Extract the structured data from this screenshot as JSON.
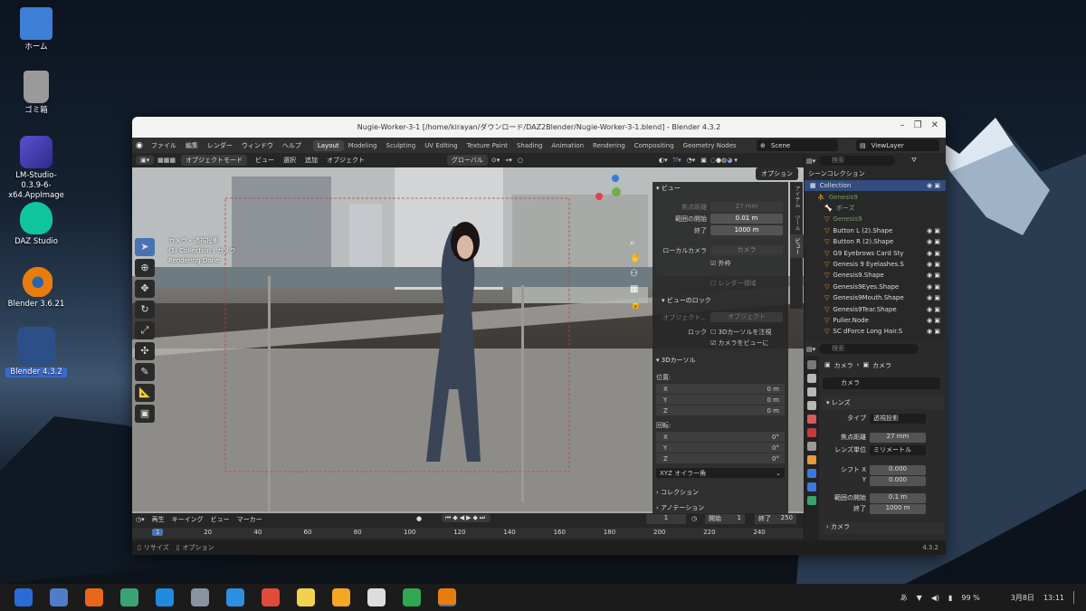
{
  "desktop": {
    "icons": [
      {
        "name": "home",
        "label": "ホーム",
        "color": "#3d7fd6"
      },
      {
        "name": "trash",
        "label": "ゴミ箱",
        "color": "#b0b0b0"
      },
      {
        "name": "lmstudio",
        "label": "LM-Studio-0.3.9-6-x64.AppImage",
        "color": "#4a3aa8"
      },
      {
        "name": "daz",
        "label": "DAZ Studio",
        "color": "#0fc5a0"
      },
      {
        "name": "blender1",
        "label": "Blender 3.6.21",
        "color": "#e87d0d"
      },
      {
        "name": "blender2",
        "label": "Blender 4.3.2",
        "color": "#e87d0d"
      }
    ]
  },
  "window": {
    "title": "Nugie-Worker-3-1 [/home/kirayan/ダウンロード/DAZ2Blender/Nugie-Worker-3-1.blend] - Blender 4.3.2"
  },
  "menus": [
    "ファイル",
    "編集",
    "レンダー",
    "ウィンドウ",
    "ヘルプ"
  ],
  "workspaces": [
    "Layout",
    "Modeling",
    "Sculpting",
    "UV Editing",
    "Texture Paint",
    "Shading",
    "Animation",
    "Rendering",
    "Compositing",
    "Geometry Nodes"
  ],
  "scene": "Scene",
  "viewlayer": "ViewLayer",
  "viewport": {
    "mode": "オブジェクトモード",
    "menu": [
      "ビュー",
      "選択",
      "追加",
      "オブジェクト"
    ],
    "orient": "グローバル",
    "options": "オプション",
    "cam1": "カメラ・透視投影",
    "cam2": "(1) Collection | カメラ",
    "cam3": "Rendering Done"
  },
  "npanel": {
    "view_title": "ビュー",
    "focal_label": "焦点距離",
    "focal": "27 mm",
    "clip_start_label": "範囲の開始",
    "clip_start": "0.01 m",
    "clip_end_label": "終了",
    "clip_end": "1000 m",
    "local_cam_label": "ローカルカメラ",
    "local_cam": "カメラ",
    "frame": "外枠",
    "render_region": "レンダー領域",
    "lock_title": "ビューのロック",
    "lock_obj_label": "オブジェクト...",
    "lock_obj": "オブジェクト",
    "lock_label": "ロック",
    "lock_cursor": "3Dカーソルを注視",
    "lock_cam": "カメラをビューに",
    "cursor_title": "3Dカーソル",
    "loc": "位置:",
    "x": "X",
    "y": "Y",
    "z": "Z",
    "zero_m": "0 m",
    "rot": "回転:",
    "zero_d": "0°",
    "euler": "XYZ オイラー角",
    "collection": "コレクション",
    "annotation": "アノテーション",
    "tabs": [
      "アイテム",
      "ツール",
      "ビュー"
    ]
  },
  "outliner": {
    "title": "シーンコレクション",
    "search": "検索",
    "rows": [
      {
        "t": "Collection",
        "i": 0
      },
      {
        "t": "Genesis9",
        "i": 1
      },
      {
        "t": "ポーズ",
        "i": 2
      },
      {
        "t": "Genesis9",
        "i": 2
      },
      {
        "t": "Button L (2).Shape",
        "i": 2
      },
      {
        "t": "Button R (2).Shape",
        "i": 2
      },
      {
        "t": "G9 Eyebrows Card Sty",
        "i": 2
      },
      {
        "t": "Genesis 9 Eyelashes.S",
        "i": 2
      },
      {
        "t": "Genesis9.Shape",
        "i": 2
      },
      {
        "t": "Genesis9Eyes.Shape",
        "i": 2
      },
      {
        "t": "Genesis9Mouth.Shape",
        "i": 2
      },
      {
        "t": "Genesis9Tear.Shape",
        "i": 2
      },
      {
        "t": "Puller.Node",
        "i": 2
      },
      {
        "t": "SC dForce Long Hair.S",
        "i": 2
      }
    ],
    "num": "156"
  },
  "props": {
    "search": "検索",
    "crumb1": "カメラ",
    "crumb2": "カメラ",
    "data": "カメラ",
    "lens": "レンズ",
    "type_label": "タイプ",
    "type": "透視投影",
    "focal_label": "焦点距離",
    "focal": "27 mm",
    "unit_label": "レンズ単位",
    "unit": "ミリメートル",
    "shiftx_label": "シフト X",
    "shiftx": "0.000",
    "shifty_label": "Y",
    "shifty": "0.000",
    "clip_start_label": "範囲の開始",
    "clip_start": "0.1 m",
    "clip_end_label": "終了",
    "clip_end": "1000 m",
    "camera": "カメラ"
  },
  "timeline": {
    "menus": [
      "再生",
      "キーイング",
      "ビュー",
      "マーカー"
    ],
    "frame": "1",
    "start_label": "開始",
    "start": "1",
    "end_label": "終了",
    "end": "250",
    "ticks": [
      "1",
      "20",
      "40",
      "60",
      "80",
      "100",
      "120",
      "140",
      "160",
      "180",
      "200",
      "220",
      "240"
    ]
  },
  "status": {
    "left1": "リサイズ",
    "left2": "オプション",
    "version": "4.3.2"
  },
  "taskbar": {
    "ime": "あ",
    "battery": "99 %",
    "date": "3月8日",
    "time": "13:11",
    "apps": [
      {
        "n": "zorin",
        "c": "#2b6bd6"
      },
      {
        "n": "files-grid",
        "c": "#4f7dc9"
      },
      {
        "n": "firefox",
        "c": "#e8671b"
      },
      {
        "n": "archive",
        "c": "#3aa374"
      },
      {
        "n": "store",
        "c": "#1e8be0"
      },
      {
        "n": "settings",
        "c": "#8a94a0"
      },
      {
        "n": "teamviewer",
        "c": "#2c8fe0"
      },
      {
        "n": "chrome",
        "c": "#e14b3b"
      },
      {
        "n": "notes",
        "c": "#f2d24c"
      },
      {
        "n": "daz",
        "c": "#f5a623"
      },
      {
        "n": "obs",
        "c": "#ddd"
      },
      {
        "n": "sheets",
        "c": "#2fa852"
      },
      {
        "n": "blender",
        "c": "#e87d0d"
      }
    ]
  }
}
